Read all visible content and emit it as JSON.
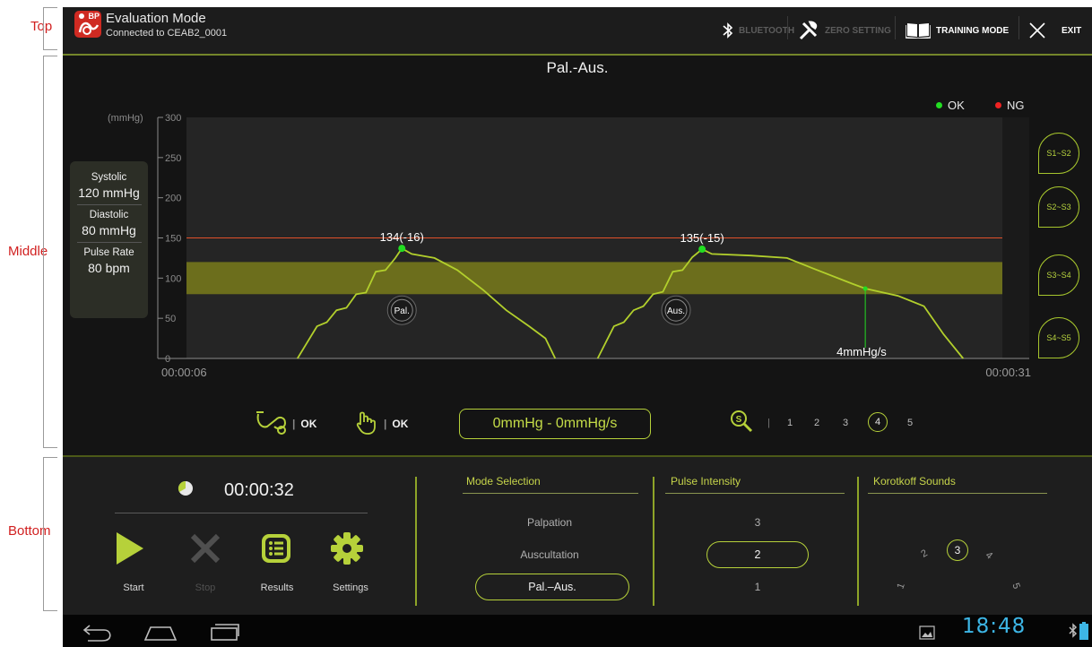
{
  "annotations": {
    "top": "Top",
    "middle": "Middle",
    "bottom": "Bottom"
  },
  "topbar": {
    "app_title": "Evaluation Mode",
    "connection": "Connected to CEAB2_0001",
    "logo_text": "BP",
    "bluetooth_label": "BLUETOOTH",
    "zero_setting_label": "ZERO SETTING",
    "training_mode_label": "TRAINING MODE",
    "exit_label": "EXIT"
  },
  "vitals": {
    "systolic_label": "Systolic",
    "systolic_value": "120 mmHg",
    "diastolic_label": "Diastolic",
    "diastolic_value": "80 mmHg",
    "pulse_label": "Pulse Rate",
    "pulse_value": "80 bpm"
  },
  "legend": {
    "ok": "OK",
    "ng": "NG",
    "ok_color": "#22dd22",
    "ng_color": "#ee2222"
  },
  "segment_buttons": [
    "S1~S2",
    "S2~S3",
    "S3~S4",
    "S4~S5"
  ],
  "chart_data": {
    "type": "line",
    "title": "Pal.-Aus.",
    "ylabel": "(mmHg)",
    "ylim": [
      0,
      300
    ],
    "yticks": [
      0,
      50,
      100,
      150,
      200,
      250,
      300
    ],
    "x_start_label": "00:00:06",
    "x_end_label": "00:00:31",
    "xlim": [
      6,
      31
    ],
    "reference_line": 150,
    "band": [
      80,
      120
    ],
    "series": [
      {
        "points": [
          [
            9.4,
            0
          ],
          [
            10.0,
            40
          ],
          [
            10.3,
            45
          ],
          [
            10.6,
            60
          ],
          [
            10.9,
            63
          ],
          [
            11.2,
            80
          ],
          [
            11.5,
            82
          ],
          [
            11.8,
            108
          ],
          [
            12.1,
            110
          ],
          [
            12.4,
            125
          ],
          [
            12.6,
            137
          ],
          [
            12.9,
            130
          ],
          [
            13.6,
            125
          ],
          [
            14.3,
            110
          ],
          [
            15.1,
            85
          ],
          [
            15.8,
            60
          ],
          [
            16.5,
            40
          ],
          [
            17.0,
            25
          ],
          [
            17.3,
            0
          ]
        ]
      },
      {
        "points": [
          [
            18.6,
            0
          ],
          [
            19.1,
            40
          ],
          [
            19.4,
            45
          ],
          [
            19.7,
            60
          ],
          [
            20.0,
            65
          ],
          [
            20.3,
            80
          ],
          [
            20.6,
            83
          ],
          [
            20.9,
            108
          ],
          [
            21.2,
            110
          ],
          [
            21.5,
            126
          ],
          [
            21.8,
            136
          ],
          [
            22.1,
            130
          ],
          [
            23.3,
            128
          ],
          [
            24.4,
            125
          ],
          [
            25.2,
            112
          ],
          [
            26.4,
            93
          ],
          [
            26.8,
            87
          ],
          [
            27.8,
            78
          ],
          [
            28.6,
            65
          ],
          [
            29.2,
            30
          ],
          [
            29.5,
            15
          ],
          [
            29.8,
            0
          ]
        ]
      }
    ],
    "markers": [
      {
        "x": 12.6,
        "y": 137,
        "label": "134(-16)"
      },
      {
        "x": 21.8,
        "y": 136,
        "label": "135(-15)"
      }
    ],
    "circle_labels": [
      {
        "x": 12.6,
        "y": 60,
        "label": "Pal."
      },
      {
        "x": 21.0,
        "y": 60,
        "label": "Aus."
      }
    ],
    "rate_marker": {
      "x": 26.8,
      "y": 87,
      "label": "4mmHg/s"
    }
  },
  "status_row": {
    "cuff_status": "OK",
    "palpation_status": "OK",
    "pressure_readout": "0mmHg - 0mmHg/s",
    "zoom_options": [
      "1",
      "2",
      "3",
      "4",
      "5"
    ],
    "zoom_selected": "4"
  },
  "controls": {
    "timer": "00:00:32",
    "start": "Start",
    "stop": "Stop",
    "results": "Results",
    "settings": "Settings"
  },
  "mode_selection": {
    "title": "Mode Selection",
    "options": [
      "Palpation",
      "Auscultation"
    ],
    "selected": "Pal.–Aus."
  },
  "pulse_intensity": {
    "title": "Pulse Intensity",
    "upper": "3",
    "selected": "2",
    "lower": "1"
  },
  "korotkoff": {
    "title": "Korotkoff Sounds",
    "n1": "1",
    "n2": "2",
    "selected": "3",
    "n4": "4",
    "n5": "5"
  },
  "navbar": {
    "clock": "18:48"
  }
}
